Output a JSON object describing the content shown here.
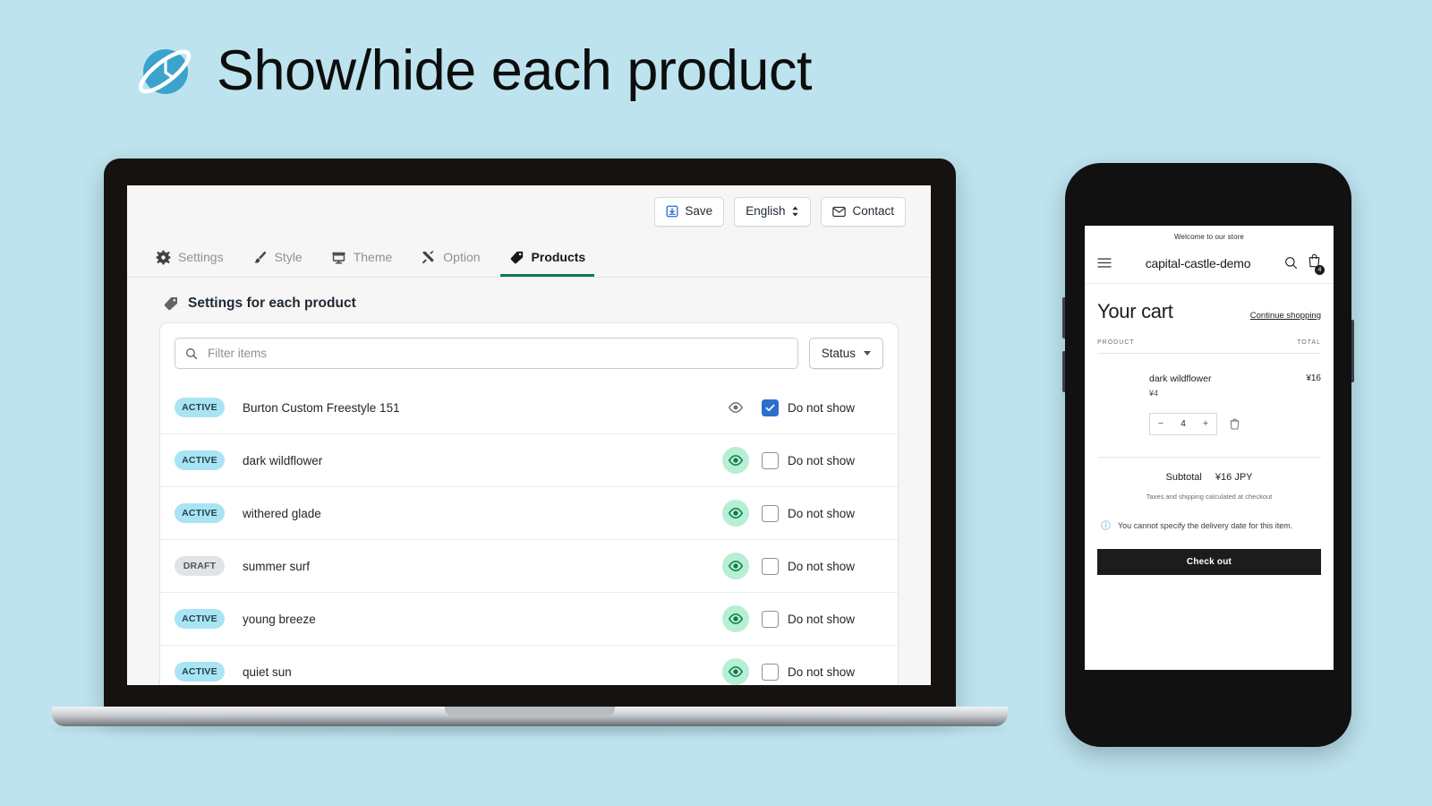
{
  "page": {
    "title": "Show/hide each product",
    "background_color": "#bde3ef",
    "logo_name": "planet-clock-logo"
  },
  "admin": {
    "toolbar": {
      "save_label": "Save",
      "language_label": "English",
      "contact_label": "Contact"
    },
    "tabs": [
      {
        "label": "Settings",
        "icon": "gear-icon",
        "active": false
      },
      {
        "label": "Style",
        "icon": "brush-icon",
        "active": false
      },
      {
        "label": "Theme",
        "icon": "storefront-icon",
        "active": false
      },
      {
        "label": "Option",
        "icon": "tools-icon",
        "active": false
      },
      {
        "label": "Products",
        "icon": "tag-icon",
        "active": true
      }
    ],
    "section": {
      "title": "Settings for each product",
      "icon": "tag-icon"
    },
    "filter": {
      "placeholder": "Filter items",
      "value": "",
      "status_label": "Status"
    },
    "checkbox_label": "Do not show",
    "accent_color": "#0b7a4b",
    "checkbox_checked_color": "#2c6ecb",
    "badge_active_color": "#a9e4f4",
    "badge_draft_color": "#e1e3e5",
    "eye_on_color": "#0b7a4b",
    "eye_off_color": "#6d7175",
    "products": [
      {
        "status": "ACTIVE",
        "name": "Burton Custom Freestyle 151",
        "visible": false,
        "do_not_show": true
      },
      {
        "status": "ACTIVE",
        "name": "dark wildflower",
        "visible": true,
        "do_not_show": false
      },
      {
        "status": "ACTIVE",
        "name": "withered glade",
        "visible": true,
        "do_not_show": false
      },
      {
        "status": "DRAFT",
        "name": "summer surf",
        "visible": true,
        "do_not_show": false
      },
      {
        "status": "ACTIVE",
        "name": "young breeze",
        "visible": true,
        "do_not_show": false
      },
      {
        "status": "ACTIVE",
        "name": "quiet sun",
        "visible": true,
        "do_not_show": false
      }
    ]
  },
  "storefront": {
    "announcement": "Welcome to our store",
    "store_name": "capital-castle-demo",
    "cart_count": "4",
    "cart_title": "Your cart",
    "continue_shopping": "Continue shopping",
    "col_product": "PRODUCT",
    "col_total": "TOTAL",
    "item": {
      "name": "dark wildflower",
      "unit_price": "¥4",
      "quantity": "4",
      "line_total": "¥16",
      "decrease_label": "−",
      "increase_label": "+"
    },
    "subtotal_label": "Subtotal",
    "subtotal_value": "¥16 JPY",
    "tax_note": "Taxes and shipping calculated at checkout",
    "delivery_note": "You cannot specify the delivery date for this item.",
    "checkout_label": "Check out"
  }
}
